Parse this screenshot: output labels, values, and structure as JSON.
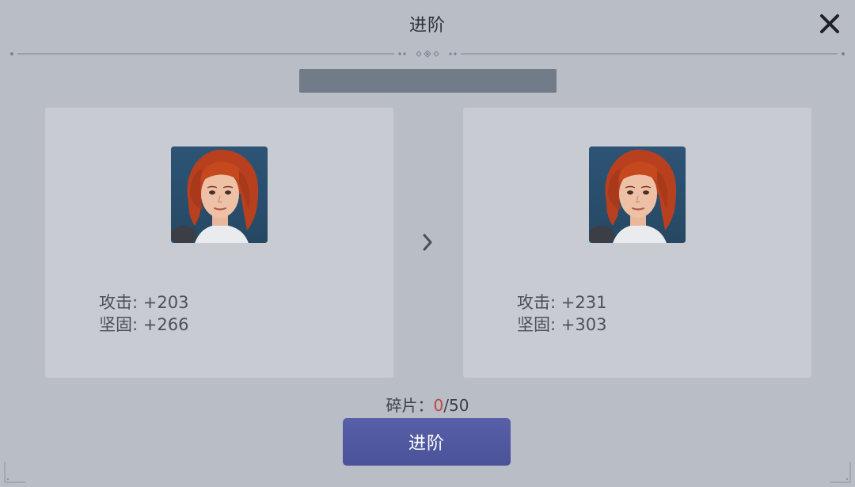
{
  "dialog": {
    "title": "进阶",
    "close_icon": "close-icon"
  },
  "current": {
    "stats": [
      {
        "label": "攻击: ",
        "value": "+203"
      },
      {
        "label": "坚固: ",
        "value": "+266"
      }
    ]
  },
  "next": {
    "stats": [
      {
        "label": "攻击: ",
        "value": "+231"
      },
      {
        "label": "坚固: ",
        "value": "+303"
      }
    ]
  },
  "fragments": {
    "label": "碎片：",
    "current": "0",
    "separator": "/",
    "required": "50"
  },
  "advance_button": {
    "label": "进阶"
  },
  "colors": {
    "background": "#b9bdc6",
    "card": "#c8cbd2",
    "button": "#4f58a0",
    "fragment_current": "#c0463f"
  }
}
